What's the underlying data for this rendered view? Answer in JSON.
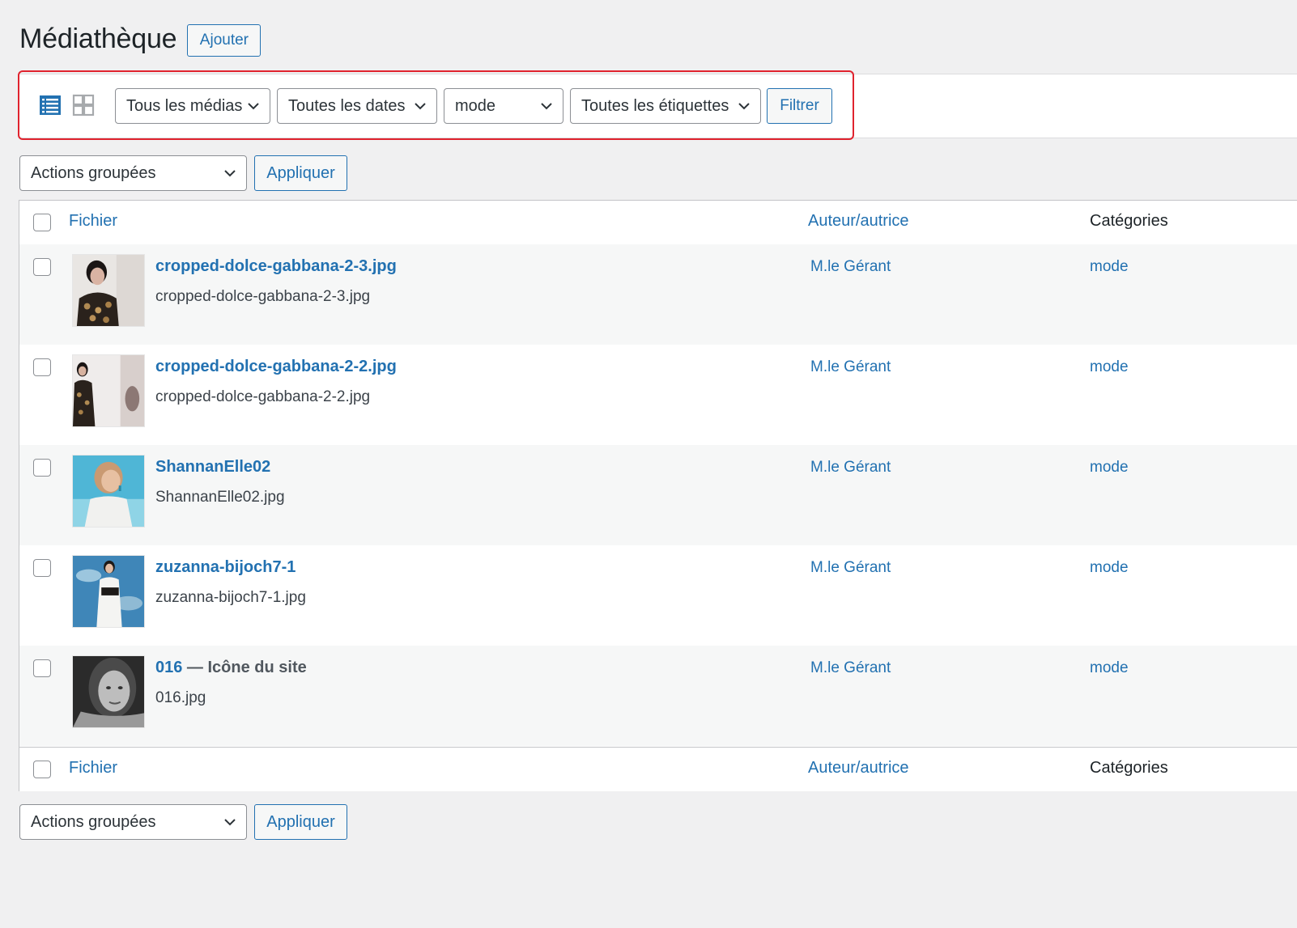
{
  "header": {
    "title": "Médiathèque",
    "add_label": "Ajouter"
  },
  "toolbar": {
    "view_list_icon": "list-view-icon",
    "view_grid_icon": "grid-view-icon",
    "filters": {
      "media": "Tous les médias",
      "dates": "Toutes les dates",
      "category": "mode",
      "tags": "Toutes les étiquettes"
    },
    "filter_label": "Filtrer"
  },
  "bulk": {
    "label": "Actions groupées",
    "apply_label": "Appliquer"
  },
  "table": {
    "columns": {
      "file": "Fichier",
      "author": "Auteur/autrice",
      "categories": "Catégories"
    },
    "rows": [
      {
        "title": "cropped-dolce-gabbana-2-3.jpg",
        "suffix": "",
        "filename": "cropped-dolce-gabbana-2-3.jpg",
        "author": "M.le Gérant",
        "category": "mode"
      },
      {
        "title": "cropped-dolce-gabbana-2-2.jpg",
        "suffix": "",
        "filename": "cropped-dolce-gabbana-2-2.jpg",
        "author": "M.le Gérant",
        "category": "mode"
      },
      {
        "title": "ShannanElle02",
        "suffix": "",
        "filename": "ShannanElle02.jpg",
        "author": "M.le Gérant",
        "category": "mode"
      },
      {
        "title": "zuzanna-bijoch7-1",
        "suffix": "",
        "filename": "zuzanna-bijoch7-1.jpg",
        "author": "M.le Gérant",
        "category": "mode"
      },
      {
        "title": "016",
        "suffix": " — Icône du site",
        "filename": "016.jpg",
        "author": "M.le Gérant",
        "category": "mode"
      }
    ]
  },
  "colors": {
    "accent": "#2271b1",
    "highlight": "#e0232e"
  }
}
